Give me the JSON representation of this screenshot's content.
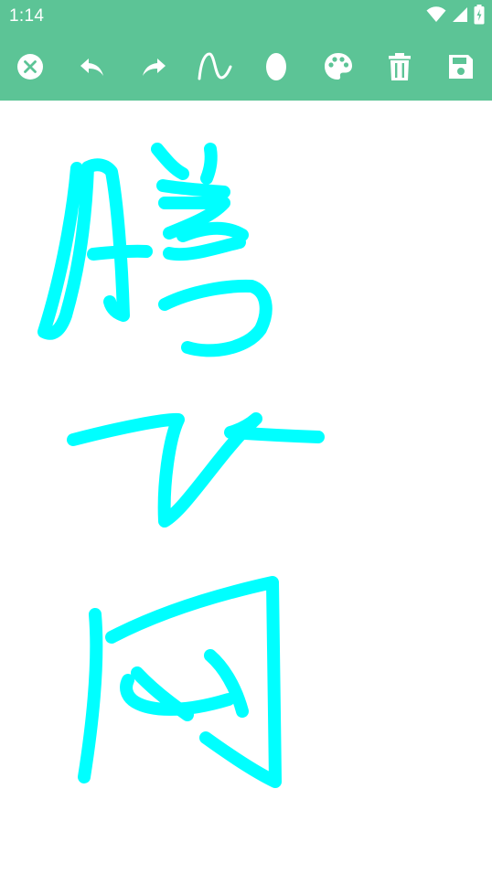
{
  "status_bar": {
    "time": "1:14",
    "icons": [
      "wifi-icon",
      "signal-icon",
      "battery-icon"
    ]
  },
  "toolbar": {
    "tools": [
      {
        "name": "close-button",
        "icon": "close-icon"
      },
      {
        "name": "undo-button",
        "icon": "undo-icon"
      },
      {
        "name": "redo-button",
        "icon": "redo-icon"
      },
      {
        "name": "brush-style-button",
        "icon": "curve-icon"
      },
      {
        "name": "brush-size-button",
        "icon": "ellipse-icon"
      },
      {
        "name": "color-palette-button",
        "icon": "palette-icon"
      },
      {
        "name": "clear-button",
        "icon": "trash-icon"
      },
      {
        "name": "save-button",
        "icon": "save-icon"
      }
    ]
  },
  "colors": {
    "toolbar_bg": "#5cc496",
    "ink": "#00ffff",
    "canvas_bg": "#ffffff"
  }
}
